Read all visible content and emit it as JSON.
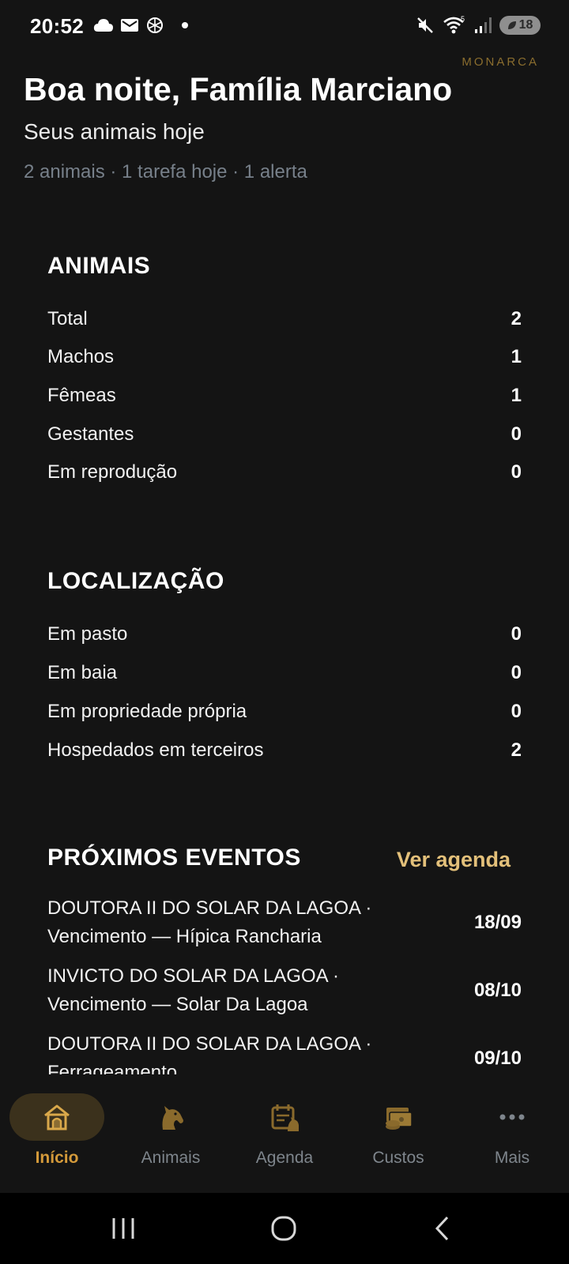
{
  "status_bar": {
    "time": "20:52",
    "battery": "18",
    "left_icons": [
      "cloud-icon",
      "mail-icon",
      "openai-icon",
      "dot-icon"
    ],
    "right_icons": [
      "mute-icon",
      "wifi-icon",
      "signal-icon",
      "battery-icon"
    ]
  },
  "brand": "MONARCA",
  "header": {
    "greeting": "Boa noite, Família Marciano",
    "subtitle": "Seus animais hoje",
    "summary": "2 animais · 1 tarefa hoje · 1 alerta"
  },
  "animals": {
    "title": "ANIMAIS",
    "rows": [
      {
        "label": "Total",
        "value": "2"
      },
      {
        "label": "Machos",
        "value": "1"
      },
      {
        "label": "Fêmeas",
        "value": "1"
      },
      {
        "label": "Gestantes",
        "value": "0"
      },
      {
        "label": "Em reprodução",
        "value": "0"
      }
    ]
  },
  "location": {
    "title": "LOCALIZAÇÃO",
    "rows": [
      {
        "label": "Em pasto",
        "value": "0"
      },
      {
        "label": "Em baia",
        "value": "0"
      },
      {
        "label": "Em propriedade própria",
        "value": "0"
      },
      {
        "label": "Hospedados em terceiros",
        "value": "2"
      }
    ]
  },
  "events": {
    "title": "PRÓXIMOS EVENTOS",
    "link": "Ver agenda",
    "items": [
      {
        "line1": "DOUTORA II DO SOLAR DA LAGOA ·",
        "line2": "Vencimento — Hípica Rancharia",
        "date": "18/09"
      },
      {
        "line1": "INVICTO DO SOLAR DA LAGOA ·",
        "line2": "Vencimento — Solar Da Lagoa",
        "date": "08/10"
      },
      {
        "line1": "DOUTORA II DO SOLAR DA LAGOA ·",
        "line2": "Ferrageamento",
        "date": "09/10"
      }
    ]
  },
  "nav": {
    "items": [
      {
        "label": "Início",
        "icon": "home-icon",
        "active": true
      },
      {
        "label": "Animais",
        "icon": "horse-icon",
        "active": false
      },
      {
        "label": "Agenda",
        "icon": "calendar-icon",
        "active": false
      },
      {
        "label": "Custos",
        "icon": "money-icon",
        "active": false
      },
      {
        "label": "Mais",
        "icon": "more-icon",
        "active": false
      }
    ]
  },
  "colors": {
    "background": "#141414",
    "accent": "#d49a3a",
    "link": "#e3c07a",
    "muted": "#77808a"
  }
}
